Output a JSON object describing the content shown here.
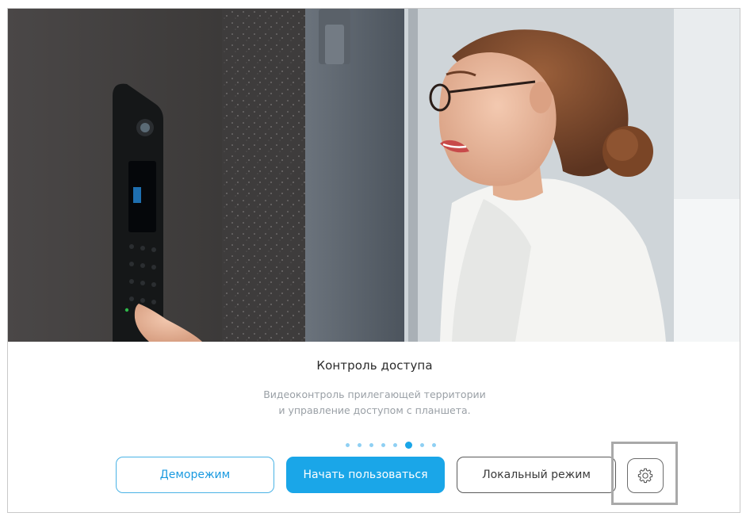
{
  "slide": {
    "title": "Контроль доступа",
    "description_line1": "Видеоконтроль прилегающей территории",
    "description_line2": "и управление доступом с планшета."
  },
  "pager": {
    "total": 8,
    "active_index": 5
  },
  "buttons": {
    "demo_label": "Деморежим",
    "start_label": "Начать пользоваться",
    "local_label": "Локальный режим"
  },
  "icons": {
    "settings": "gear-icon"
  },
  "colors": {
    "accent": "#1aa6e8",
    "dot_inactive": "#8fd0f3",
    "title_text": "#2b2b2b",
    "description_text": "#9aa0a6"
  }
}
